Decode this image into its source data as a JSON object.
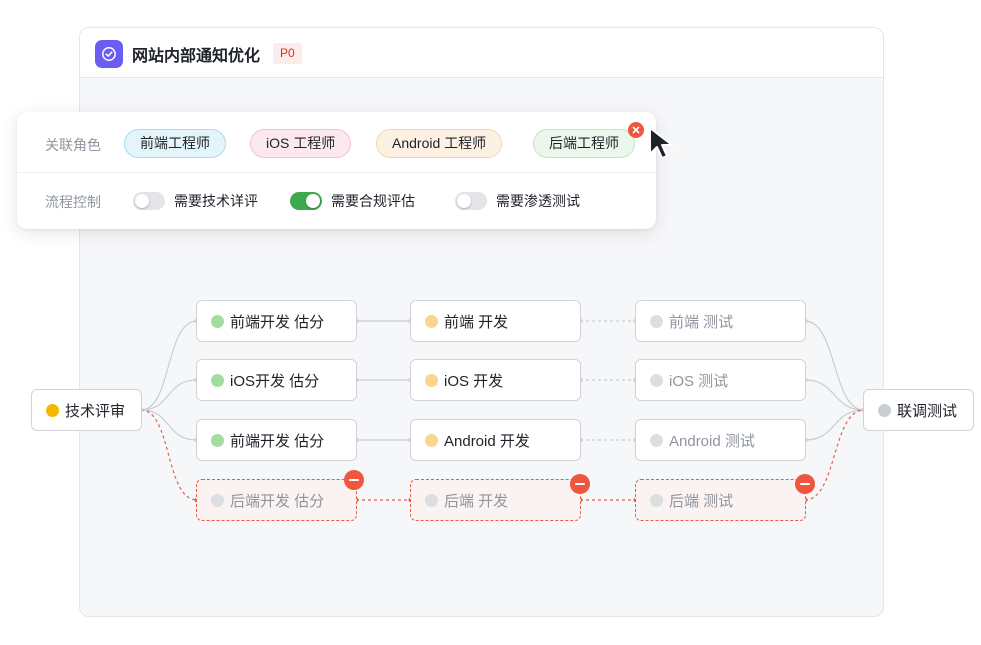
{
  "card": {
    "title": "网站内部通知优化",
    "priority": "P0"
  },
  "panel": {
    "roles_label": "关联角色",
    "roles": [
      {
        "label": "前端工程师",
        "bg": "#e3f4fa",
        "border": "#a9ddee"
      },
      {
        "label": "iOS 工程师",
        "bg": "#fbe9ee",
        "border": "#f3c3cf"
      },
      {
        "label": "Android 工程师",
        "bg": "#fcf1e2",
        "border": "#f2d6ac"
      },
      {
        "label": "后端工程师",
        "bg": "#ebf7ea",
        "border": "#c3e5c1"
      }
    ],
    "flow_label": "流程控制",
    "toggles": [
      {
        "label": "需要技术详评",
        "on": false
      },
      {
        "label": "需要合规评估",
        "on": true
      },
      {
        "label": "需要渗透测试",
        "on": false
      }
    ]
  },
  "colors": {
    "accent": "#6b5cf2",
    "toggle_on": "#3daa4f",
    "toggle_off": "#e3e5e8",
    "removed": "#ea5a47"
  },
  "flow": {
    "start": {
      "label": "技术评审",
      "status": "in-progress",
      "color": "#f5b800"
    },
    "end": {
      "label": "联调测试",
      "status": "pending",
      "color": "#c9cdd4"
    },
    "rows": [
      {
        "estimate": {
          "label": "前端开发 估分",
          "color": "#a4dca0"
        },
        "develop": {
          "label": "前端 开发",
          "color": "#fad58e"
        },
        "test": {
          "label": "前端 测试",
          "color": "#dcdee1"
        },
        "removed": false
      },
      {
        "estimate": {
          "label": "iOS开发 估分",
          "color": "#a4dca0"
        },
        "develop": {
          "label": "iOS 开发",
          "color": "#fad58e"
        },
        "test": {
          "label": "iOS 测试",
          "color": "#dcdee1"
        },
        "removed": false
      },
      {
        "estimate": {
          "label": "前端开发 估分",
          "color": "#a4dca0"
        },
        "develop": {
          "label": "Android 开发",
          "color": "#fad58e"
        },
        "test": {
          "label": "Android 测试",
          "color": "#dcdee1"
        },
        "removed": false
      },
      {
        "estimate": {
          "label": "后端开发 估分",
          "color": "#dcdee1"
        },
        "develop": {
          "label": "后端 开发",
          "color": "#dcdee1"
        },
        "test": {
          "label": "后端 测试",
          "color": "#dcdee1"
        },
        "removed": true
      }
    ]
  }
}
